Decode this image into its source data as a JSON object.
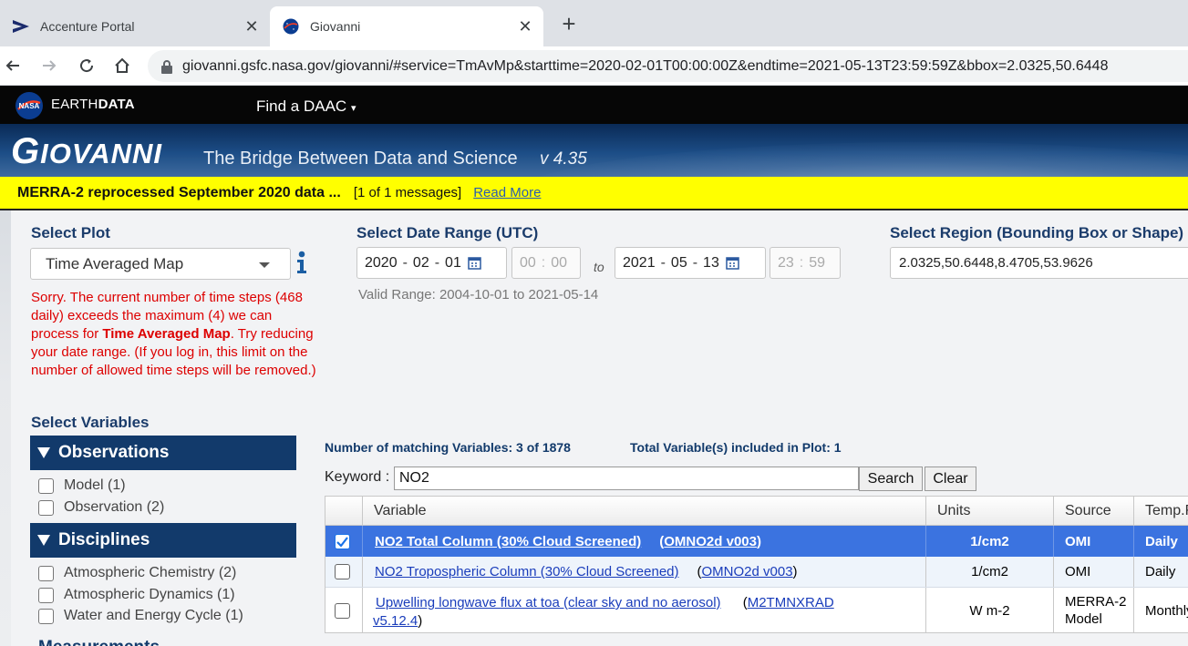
{
  "browser": {
    "tabs": [
      {
        "title": "Accenture Portal",
        "icon": "accenture-icon"
      },
      {
        "title": "Giovanni",
        "icon": "nasa-icon"
      }
    ],
    "url": "giovanni.gsfc.nasa.gov/giovanni/#service=TmAvMp&starttime=2020-02-01T00:00:00Z&endtime=2021-05-13T23:59:59Z&bbox=2.0325,50.6448"
  },
  "earthdata": {
    "brand_prefix": "EARTH",
    "brand_bold": "DATA",
    "menu": "Find a DAAC"
  },
  "banner": {
    "title_first": "G",
    "title_rest": "IOVANNI",
    "subtitle": "The Bridge Between Data and Science",
    "version": "v 4.35"
  },
  "message": {
    "text": "MERRA-2 reprocessed September 2020 data ...",
    "count": "[1 of 1 messages]",
    "link": "Read More"
  },
  "plot": {
    "label": "Select Plot",
    "selected": "Time Averaged Map",
    "error_part1": "Sorry. The current number of time steps (468 daily) exceeds the maximum (4) we can process for ",
    "error_bold": "Time Averaged Map",
    "error_part2": ". Try reducing your date range. (If you log in, this limit on the number of allowed time steps will be removed.)"
  },
  "date_range": {
    "label": "Select Date Range (UTC)",
    "start": {
      "year": "2020",
      "month": "02",
      "day": "01",
      "hour": "00",
      "minute": "00"
    },
    "end": {
      "year": "2021",
      "month": "05",
      "day": "13",
      "hour": "23",
      "minute": "59"
    },
    "to": "to",
    "valid_range": "Valid Range: 2004-10-01 to 2021-05-14"
  },
  "region": {
    "label": "Select Region (Bounding Box or Shape)",
    "value": "2.0325,50.6448,8.4705,53.9626"
  },
  "variables": {
    "label": "Select Variables",
    "facets": [
      {
        "title": "Observations",
        "items": [
          "Model (1)",
          "Observation (2)"
        ]
      },
      {
        "title": "Disciplines",
        "items": [
          "Atmospheric Chemistry (2)",
          "Atmospheric Dynamics (1)",
          "Water and Energy Cycle (1)"
        ]
      }
    ],
    "next_facet": "Measurements",
    "matching": "Number of matching Variables: 3 of 1878",
    "included": "Total Variable(s) included in Plot: 1",
    "keyword_label": "Keyword :",
    "keyword": "NO2",
    "search_btn": "Search",
    "clear_btn": "Clear",
    "columns": [
      "Variable",
      "Units",
      "Source",
      "Temp.Res."
    ],
    "rows": [
      {
        "name": "NO2 Total Column (30% Cloud Screened)",
        "product": "OMNO2d v003",
        "units": "1/cm2",
        "source": "OMI",
        "temp": "Daily",
        "checked": true
      },
      {
        "name": "NO2 Tropospheric Column (30% Cloud Screened)",
        "product": "OMNO2d v003",
        "units": "1/cm2",
        "source": "OMI",
        "temp": "Daily",
        "checked": false
      },
      {
        "name": "Upwelling longwave flux at toa (clear sky and no aerosol)",
        "product": "M2TMNXRAD",
        "product_line2": "v5.12.4",
        "units": "W m-2",
        "source": "MERRA-2 Model",
        "temp": "Monthly",
        "checked": false
      }
    ]
  }
}
